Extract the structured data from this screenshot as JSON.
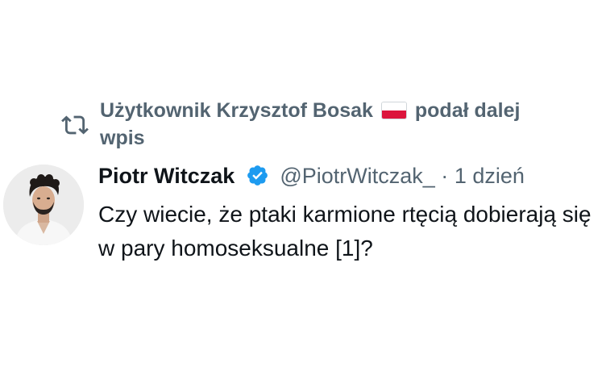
{
  "retweet": {
    "text_before_flag": "Użytkownik Krzysztof Bosak",
    "text_after_flag": "podał dalej wpis",
    "flag_name": "poland-flag"
  },
  "tweet": {
    "author_name": "Piotr Witczak",
    "handle": "@PiotrWitczak_",
    "separator": "·",
    "time": "1 dzień",
    "text": "Czy wiecie, że ptaki karmione rtęcią dobierają się w pary homoseksualne [1]?"
  },
  "colors": {
    "secondary_text": "#536471",
    "primary_text": "#0f1419",
    "verified_blue": "#1d9bf0"
  }
}
